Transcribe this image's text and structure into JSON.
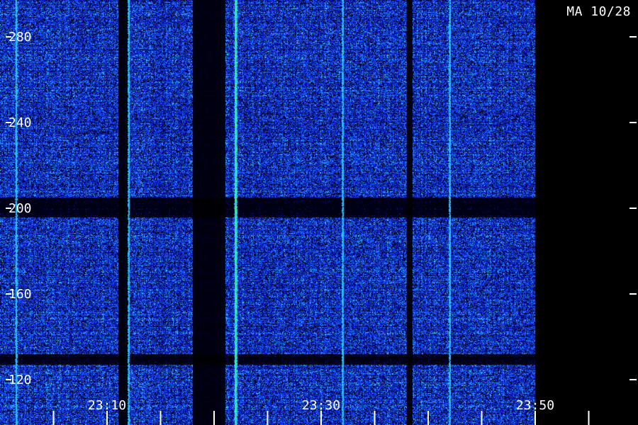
{
  "header": {
    "station_label": "MA 10/28"
  },
  "colors": {
    "background": "#000000",
    "low": "#0a0a5a",
    "mid": "#1f3cff",
    "high": "#35c2ff",
    "peak": "#43ff88",
    "text": "#ffffff"
  },
  "chart_data": {
    "type": "heatmap",
    "title": "",
    "xlabel": "",
    "ylabel": "",
    "x_axis": {
      "unit": "time",
      "range": [
        "23:00",
        "23:50"
      ],
      "ticks_labeled": [
        "23:10",
        "23:30",
        "23:50"
      ],
      "minor_tick_interval_min": 5
    },
    "y_axis": {
      "range": [
        110,
        290
      ],
      "ticks": [
        120,
        160,
        200,
        240,
        280
      ]
    },
    "dark_vertical_bands": [
      {
        "from": "23:11",
        "to": "23:12"
      },
      {
        "from": "23:18",
        "to": "23:21"
      },
      {
        "from": "23:38",
        "to": "23:38.5"
      }
    ],
    "bright_lines": [
      {
        "at": "23:22",
        "intensity": "high"
      },
      {
        "at": "23:32",
        "intensity": "medium"
      },
      {
        "at": "23:42",
        "intensity": "medium"
      },
      {
        "at": "23:12",
        "intensity": "medium"
      },
      {
        "at": "23:01.5",
        "intensity": "medium"
      }
    ],
    "dark_horizontal_bands": [
      {
        "from": 127,
        "to": 132
      },
      {
        "from": 196,
        "to": 205
      }
    ],
    "data_end": "23:50",
    "legend": "none",
    "grid": false
  }
}
